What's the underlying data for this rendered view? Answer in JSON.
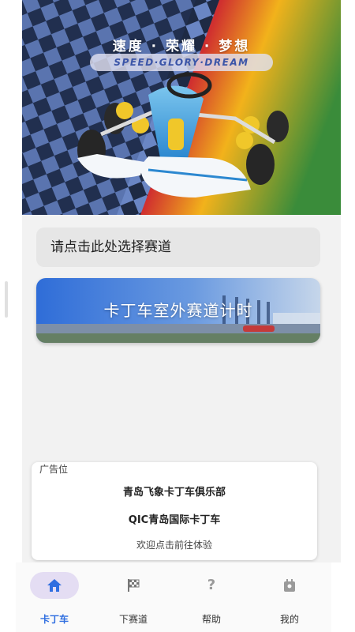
{
  "hero": {
    "slogan": "速度 · 荣耀 · 梦想",
    "subtitle": "SPEED·GLORY·DREAM"
  },
  "track_selector": {
    "placeholder": "请点击此处选择赛道"
  },
  "timing_card": {
    "title": "卡丁车室外赛道计时"
  },
  "ad": {
    "label": "广告位",
    "items": [
      "青岛飞象卡丁车俱乐部",
      "QIC青岛国际卡丁车"
    ],
    "hint": "欢迎点击前往体验"
  },
  "nav": {
    "items": [
      {
        "label": "卡丁车",
        "icon": "home-icon",
        "active": true
      },
      {
        "label": "下赛道",
        "icon": "checkered-flag-icon",
        "active": false
      },
      {
        "label": "帮助",
        "icon": "question-icon",
        "active": false
      },
      {
        "label": "我的",
        "icon": "profile-icon",
        "active": false
      }
    ],
    "active_color": "#2f6ee0"
  }
}
